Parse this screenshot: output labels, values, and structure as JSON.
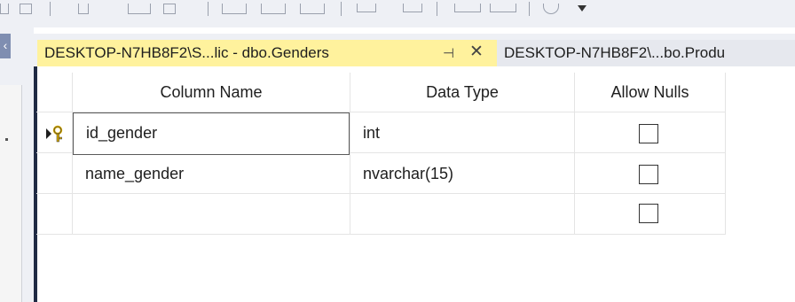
{
  "tabs": {
    "active": {
      "title": "DESKTOP-N7HB8F2\\S...lic - dbo.Genders",
      "pin_icon": "pin-icon",
      "close_icon": "close-icon",
      "close_glyph": "✕",
      "pin_glyph": "⊣"
    },
    "inactive": {
      "title": "DESKTOP-N7HB8F2\\...bo.Produ"
    }
  },
  "grid": {
    "headers": [
      "Column Name",
      "Data Type",
      "Allow Nulls"
    ],
    "rows": [
      {
        "column_name": "id_gender",
        "data_type": "int",
        "allow_nulls": false,
        "primary_key": true
      },
      {
        "column_name": "name_gender",
        "data_type": "nvarchar(15)",
        "allow_nulls": false,
        "primary_key": false
      },
      {
        "column_name": "",
        "data_type": "",
        "allow_nulls": false,
        "primary_key": false
      }
    ]
  },
  "colors": {
    "active_tab": "#fff29d",
    "inactive_tab": "#e6e8ee",
    "toolbar": "#eef0f5",
    "key_icon": "#e8b800"
  }
}
